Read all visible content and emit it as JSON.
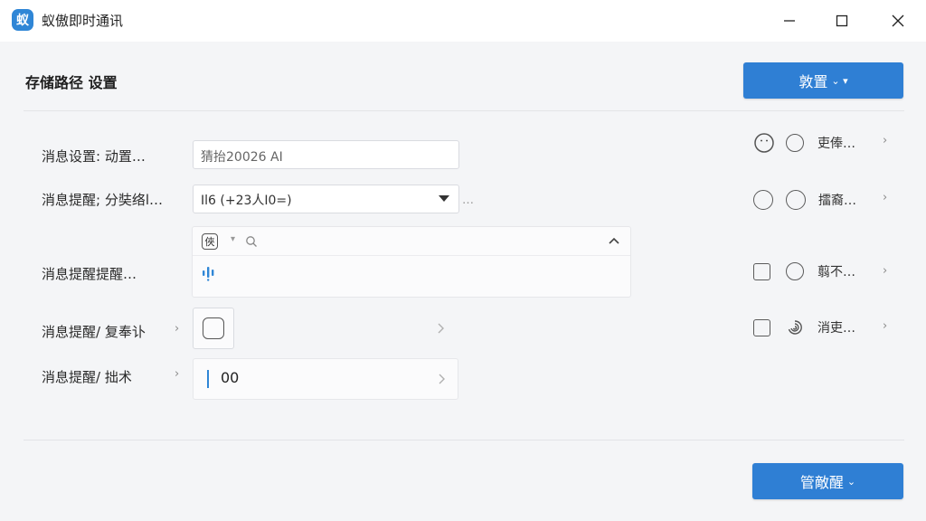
{
  "window": {
    "logo_text": "蚁",
    "title": "蚁傲即时通讯",
    "minimize_icon": "minimize-icon",
    "maximize_icon": "maximize-icon",
    "close_icon": "close-icon"
  },
  "header": {
    "title": "存储路径 设置",
    "primary_button_label": "敦置",
    "primary_button_caret": "⌄ ▾"
  },
  "rows": [
    {
      "label": "消息设置: 动置…",
      "field_value": "猜抬20026 AI"
    },
    {
      "label": "消息提醒; 分奘络l…",
      "field_value": "Il6 (+23人I0=)",
      "trailing_text": "…"
    },
    {
      "label": "消息提醒提醒…"
    },
    {
      "label": "消息提醒/ 复奉讣",
      "chevron": "›"
    },
    {
      "label": "消息提醒/ 拙术",
      "chevron": "›",
      "field_value": "00"
    }
  ],
  "dropdown_panel": {
    "badge_text": "俠",
    "toolbar_caret": "▾",
    "collapse_chevron": "⌃"
  },
  "right_options": [
    {
      "label": "吏俸…"
    },
    {
      "label": "擂裔…"
    },
    {
      "label": "翦不…"
    },
    {
      "label": "消吏…"
    }
  ],
  "footer": {
    "button_label": "管敵醒",
    "button_caret": "⌄"
  },
  "colors": {
    "accent": "#2f7fd4",
    "panel_bg": "#f4f5f7",
    "cursor": "#2f86d6"
  }
}
